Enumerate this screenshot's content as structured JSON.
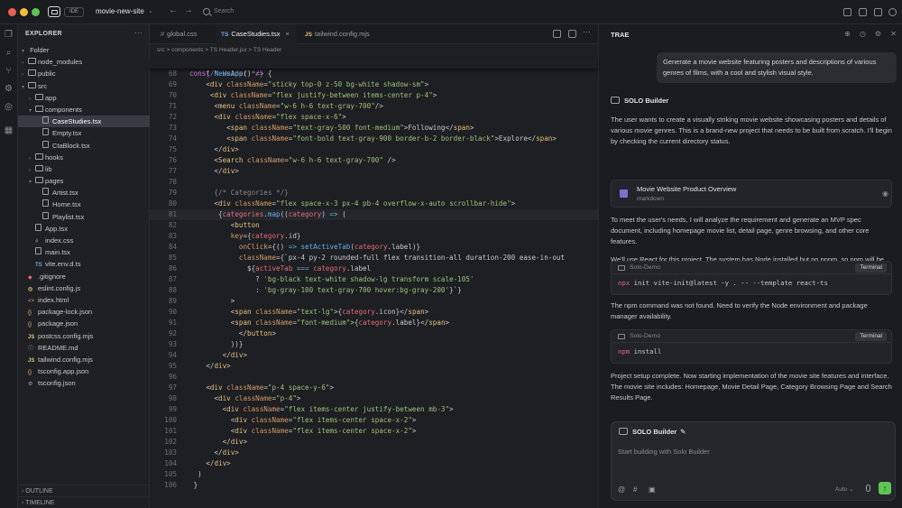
{
  "titlebar": {
    "ide_badge": "IDE",
    "project": "movie-new-site",
    "search_placeholder": "Search"
  },
  "explorer": {
    "title": "EXPLORER",
    "folder_header": "Folder",
    "items": [
      {
        "label": "node_modules",
        "depth": 1,
        "kind": "folder",
        "expanded": false
      },
      {
        "label": "public",
        "depth": 1,
        "kind": "folder",
        "expanded": false
      },
      {
        "label": "src",
        "depth": 1,
        "kind": "folder",
        "expanded": true
      },
      {
        "label": "app",
        "depth": 2,
        "kind": "folder",
        "expanded": false
      },
      {
        "label": "components",
        "depth": 2,
        "kind": "folder",
        "expanded": true
      },
      {
        "label": "CaseStudies.tsx",
        "depth": 3,
        "kind": "file",
        "selected": true
      },
      {
        "label": "Empty.tsx",
        "depth": 3,
        "kind": "file"
      },
      {
        "label": "CtaBlock.tsx",
        "depth": 3,
        "kind": "file"
      },
      {
        "label": "hooks",
        "depth": 2,
        "kind": "folder",
        "expanded": false
      },
      {
        "label": "lib",
        "depth": 2,
        "kind": "folder",
        "expanded": false
      },
      {
        "label": "pages",
        "depth": 2,
        "kind": "folder",
        "expanded": true
      },
      {
        "label": "Artist.tsx",
        "depth": 3,
        "kind": "file"
      },
      {
        "label": "Home.tsx",
        "depth": 3,
        "kind": "file"
      },
      {
        "label": "Playlist.tsx",
        "depth": 3,
        "kind": "file"
      },
      {
        "label": "App.tsx",
        "depth": 2,
        "kind": "file"
      },
      {
        "label": "index.css",
        "depth": 2,
        "kind": "css",
        "icon": "#"
      },
      {
        "label": "main.tsx",
        "depth": 2,
        "kind": "file"
      },
      {
        "label": "vite.env.d.ts",
        "depth": 2,
        "kind": "ts",
        "icon": "TS"
      },
      {
        "label": ".gitignore",
        "depth": 1,
        "kind": "git",
        "icon": "◆"
      },
      {
        "label": "eslint.config.js",
        "depth": 1,
        "kind": "js",
        "icon": "◎"
      },
      {
        "label": "index.html",
        "depth": 1,
        "kind": "html",
        "icon": "<>"
      },
      {
        "label": "package-lock.json",
        "depth": 1,
        "kind": "json",
        "icon": "{}"
      },
      {
        "label": "package.json",
        "depth": 1,
        "kind": "json",
        "icon": "{}"
      },
      {
        "label": "postcss.config.mjs",
        "depth": 1,
        "kind": "js",
        "icon": "JS"
      },
      {
        "label": "README.md",
        "depth": 1,
        "kind": "md",
        "icon": "ⓘ"
      },
      {
        "label": "tailwind.config.mjs",
        "depth": 1,
        "kind": "js",
        "icon": "JS"
      },
      {
        "label": "tsconfig.app.json",
        "depth": 1,
        "kind": "json",
        "icon": "{}"
      },
      {
        "label": "tsconfig.json",
        "depth": 1,
        "kind": "gear",
        "icon": "⚙"
      }
    ],
    "outline": "OUTLINE",
    "timeline": "TIMELINE"
  },
  "editor": {
    "tabs": [
      {
        "label": "global.css",
        "prefix": "#",
        "active": false
      },
      {
        "label": "CaseStudies.tsx",
        "prefix": "TS",
        "active": true
      },
      {
        "label": "tailwind.config.mjs",
        "prefix": "JS",
        "active": false
      }
    ],
    "breadcrumb": "src  >  components  >  TS Header.jsx  >  TS Header",
    "sticky": "const NewsApp() => {",
    "lines": [
      {
        "n": "68",
        "t": "    {/* Header */}",
        "k": "cm"
      },
      {
        "n": "69",
        "t": "    <div className=\"sticky top-0 z-50 bg-white shadow-sm\">"
      },
      {
        "n": "70",
        "t": "     <div className=\"flex justify-between items-center p-4\">"
      },
      {
        "n": "71",
        "t": "      <menu className=\"w-6 h-6 text-gray-700\"/>"
      },
      {
        "n": "72",
        "t": "      <div className=\"flex space-x-6\">"
      },
      {
        "n": "73",
        "t": "         <span className=\"text-gray-500 font-medium\">Following</span>"
      },
      {
        "n": "74",
        "t": "         <span className=\"font-bold text-gray-900 border-b-2 border-black\">Explore</span>"
      },
      {
        "n": "75",
        "t": "      </div>"
      },
      {
        "n": "76",
        "t": "      <Search className=\"w-6 h-6 text-gray-700\" />"
      },
      {
        "n": "77",
        "t": "      </div>"
      },
      {
        "n": "78",
        "t": "      "
      },
      {
        "n": "79",
        "t": "      {/* Categories */}",
        "k": "cm"
      },
      {
        "n": "80",
        "t": "      <div className=\"flex space-x-3 px-4 pb-4 overflow-x-auto scrollbar-hide\">"
      },
      {
        "n": "81",
        "t": "       {categories.map((category) => (",
        "hl": true
      },
      {
        "n": "82",
        "t": "          <button"
      },
      {
        "n": "83",
        "t": "          key={category.id}"
      },
      {
        "n": "84",
        "t": "            onClick={() => setActiveTab(category.label)}"
      },
      {
        "n": "85",
        "t": "            className={`px-4 py-2 rounded-full flex transition-all duration-200 ease-in-out"
      },
      {
        "n": "86",
        "t": "              ${activeTab === category.label"
      },
      {
        "n": "87",
        "t": "                ? 'bg-black text-white shadow-lg transform scale-105'"
      },
      {
        "n": "88",
        "t": "                : 'bg-gray-100 text-gray-700 hover:bg-gray-200'}`}"
      },
      {
        "n": "89",
        "t": "          >"
      },
      {
        "n": "90",
        "t": "          <span className=\"text-lg\">{category.icon}</span>"
      },
      {
        "n": "91",
        "t": "          <span className=\"font-medium\">{category.label}</span>"
      },
      {
        "n": "92",
        "t": "            </button>"
      },
      {
        "n": "93",
        "t": "          ))}"
      },
      {
        "n": "94",
        "t": "        </div>"
      },
      {
        "n": "95",
        "t": "    </div>"
      },
      {
        "n": "96",
        "t": "    "
      },
      {
        "n": "97",
        "t": "    <div className=\"p-4 space-y-6\">"
      },
      {
        "n": "98",
        "t": "      <div className=\"p-4\">"
      },
      {
        "n": "99",
        "t": "        <div className=\"flex items-center justify-between mb-3\">"
      },
      {
        "n": "100",
        "t": "          <div className=\"flex items-center space-x-2\">"
      },
      {
        "n": "101",
        "t": "          <div className=\"flex items-center space-x-2\">"
      },
      {
        "n": "102",
        "t": "        </div>"
      },
      {
        "n": "103",
        "t": "      </div>"
      },
      {
        "n": "104",
        "t": "    </div>"
      },
      {
        "n": "105",
        "t": "  )"
      },
      {
        "n": "106",
        "t": " }"
      }
    ]
  },
  "panel": {
    "title": "TRAE",
    "user_message": "Generate a movie website featuring posters and descriptions of various genres of films, with a cool and stylish visual style.",
    "builder_name": "SOLO Builder",
    "para1": "The user wants to create a visually striking movie website showcasing posters and details of various movie genres. This is a brand-new project that needs to be built from scratch. I'll begin by checking the current directory status.",
    "doc_title": "Movie Website Product Overview",
    "doc_sub": "markdown",
    "para2": "To meet the user's needs, I will analyze the requirement and generate an MVP spec document, including homepage movie list, detail page, genre browsing, and other core features.",
    "para3": "We'll use React for this project. The system has Node installed but no pnpm, so npm will be used to initialize a React + TypeScript project.",
    "term1": {
      "title": "Solo-Demo",
      "badge": "Terminal",
      "kw": "npx",
      "cmd": " init vite-init@latest -y . -- --template react-ts"
    },
    "para4": "The npm command was not found. Need to verify the Node environment and package manager availability.",
    "term2": {
      "title": "Solo-Demo",
      "badge": "Terminal",
      "kw": "npm",
      "cmd": " install"
    },
    "para5": "Project setup complete. Now starting implementation of the movie site features and interface. The movie site includes: Homepage, Movie Detail Page, Category Browsing Page and Search Results Page.",
    "composer": {
      "head": "SOLO Builder",
      "placeholder": "Start building with Solo Builder",
      "mode": "Auto"
    }
  }
}
